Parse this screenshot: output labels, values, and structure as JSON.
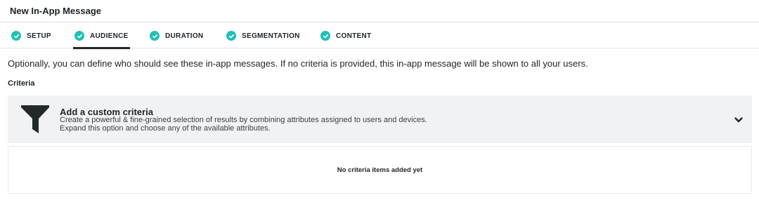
{
  "header": {
    "title": "New In-App Message"
  },
  "tabs": [
    {
      "label": "SETUP",
      "icon": "check-circle-icon",
      "active": false
    },
    {
      "label": "AUDIENCE",
      "icon": "check-circle-icon",
      "active": true
    },
    {
      "label": "DURATION",
      "icon": "check-circle-icon",
      "active": false
    },
    {
      "label": "SEGMENTATION",
      "icon": "check-circle-icon",
      "active": false
    },
    {
      "label": "CONTENT",
      "icon": "check-circle-icon",
      "active": false
    }
  ],
  "colors": {
    "accent": "#20c0b8",
    "active_underline": "#23282b",
    "panel_bg": "#f1f2f3"
  },
  "main": {
    "intro": "Optionally, you can define who should see these in-app messages. If no criteria is provided, this in-app message will be shown to all your users.",
    "criteria_label": "Criteria",
    "criteria_panel": {
      "icon": "funnel-icon",
      "title": "Add a custom criteria",
      "description_line1": "Create a powerful & fine-grained selection of results by combining attributes assigned to users and devices.",
      "description_line2": "Expand this option and choose any of the available attributes.",
      "toggle_icon": "chevron-down-icon"
    },
    "empty_state": "No criteria items added yet"
  }
}
